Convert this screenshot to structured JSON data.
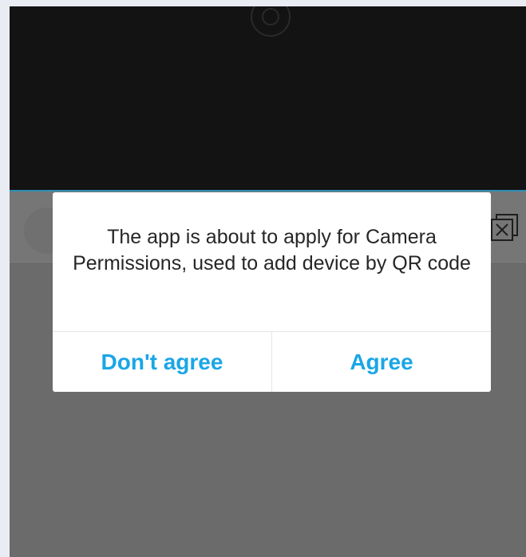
{
  "dialog": {
    "message": "The app is about to apply for Camera Permissions, used to add device by QR code",
    "decline_label": "Don't agree",
    "accept_label": "Agree"
  },
  "colors": {
    "accent": "#1aa6e6",
    "overlay": "#6b6b6b",
    "camera_background": "#131313"
  },
  "icons": {
    "camera": "camera-icon",
    "close": "close-icon"
  }
}
